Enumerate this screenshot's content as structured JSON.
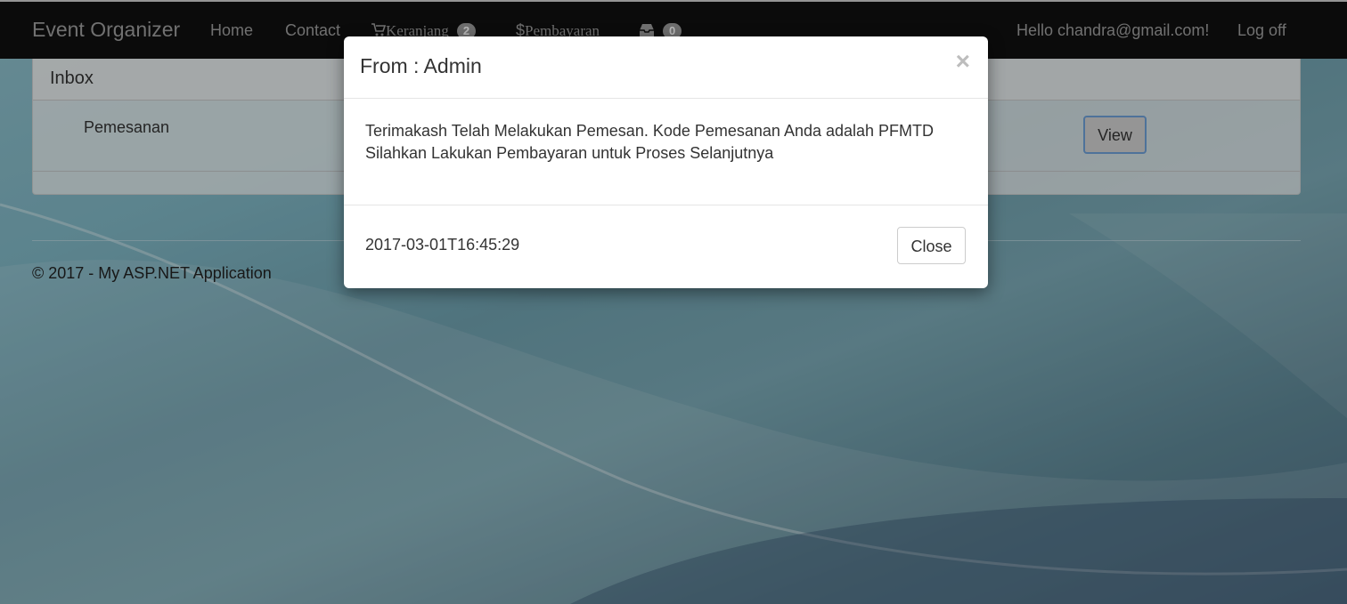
{
  "navbar": {
    "brand": "Event Organizer",
    "home": "Home",
    "contact": "Contact",
    "cart_label": "Keranjang",
    "cart_count": "2",
    "payment_symbol": "$",
    "payment_label": "Pembayaran",
    "inbox_count": "0",
    "greeting": "Hello chandra@gmail.com!",
    "logoff": "Log off",
    "icons": [
      "cart-icon",
      "inbox-icon"
    ]
  },
  "panel": {
    "title": "Inbox",
    "rows": [
      {
        "subject": "Pemesanan",
        "action": "View"
      }
    ]
  },
  "footer": {
    "copyright": "© 2017 - My ASP.NET Application"
  },
  "modal": {
    "title": "From : Admin",
    "close_x": "×",
    "lines": [
      "Terimakash Telah Melakukan Pemesan. Kode Pemesanan Anda adalah PFMTD",
      "Silahkan Lakukan Pembayaran untuk Proses Selanjutnya"
    ],
    "date": "2017-03-01T16:45:29",
    "close_label": "Close"
  },
  "colors": {
    "navbar_bg": "#101010",
    "nav_text": "#9d9d9d",
    "view_border": "#6d9ed6"
  }
}
